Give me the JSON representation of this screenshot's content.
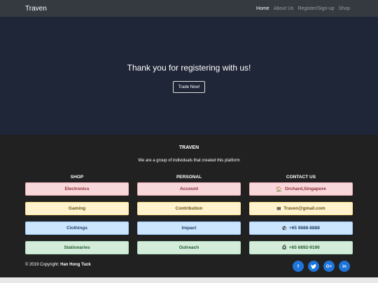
{
  "navbar": {
    "brand": "Traven",
    "links": [
      "Home",
      "About Us",
      "Register/Sign-up",
      "Shop"
    ]
  },
  "hero": {
    "title": "Thank you for registering with us!",
    "button_label": "Trade Now!"
  },
  "footer": {
    "title": "TRAVEN",
    "subtitle": "We are a group of individuals that created this platform",
    "columns": {
      "shop": {
        "heading": "SHOP",
        "items": [
          "Electronics",
          "Gaming",
          "Clothings",
          "Stationaries"
        ]
      },
      "personal": {
        "heading": "PERSONAL",
        "items": [
          "Account",
          "Contribution",
          "Impact",
          "Outreach"
        ]
      },
      "contact": {
        "heading": "CONTACT US",
        "items": [
          "Orchard,Singapore",
          "Traven@gmail.com",
          "+65 9888-8888",
          "+65 6892-9190"
        ],
        "icons": [
          "home-icon",
          "envelope-icon",
          "phone-icon",
          "fax-icon"
        ]
      }
    },
    "copyright_prefix": "© 2019 Copyright:",
    "copyright_name": "Han Hong Tuck",
    "social": [
      {
        "name": "facebook-icon",
        "glyph": "f"
      },
      {
        "name": "twitter-icon",
        "glyph": "🐦"
      },
      {
        "name": "google-plus-icon",
        "glyph": "G+"
      },
      {
        "name": "linkedin-icon",
        "glyph": "in"
      }
    ]
  }
}
